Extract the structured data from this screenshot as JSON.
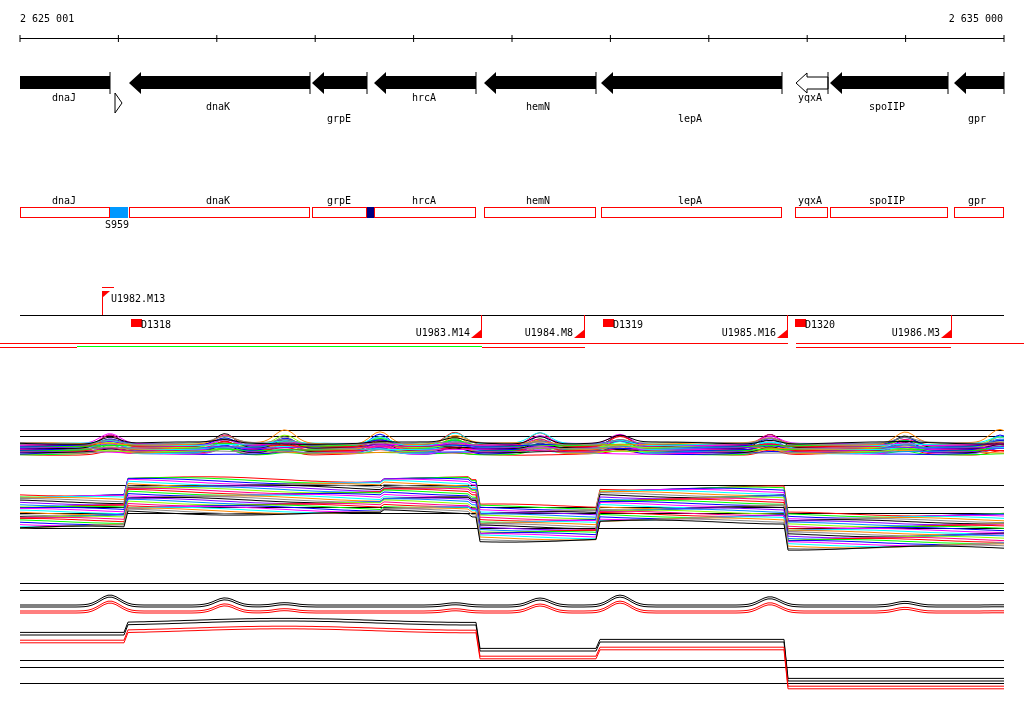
{
  "ruler": {
    "start_label": "2 625 001",
    "end_label": "2 635 000"
  },
  "genes": [
    {
      "name": "dnaJ",
      "kind": "block"
    },
    {
      "name": "dnaK",
      "kind": "arrow"
    },
    {
      "name": "grpE",
      "kind": "arrow"
    },
    {
      "name": "hrcA",
      "kind": "arrow"
    },
    {
      "name": "hemN",
      "kind": "arrow"
    },
    {
      "name": "lepA",
      "kind": "arrow"
    },
    {
      "name": "yqxA",
      "kind": "open-arrow"
    },
    {
      "name": "spoIIP",
      "kind": "arrow"
    },
    {
      "name": "gpr",
      "kind": "arrow"
    }
  ],
  "features": [
    {
      "label": "dnaJ"
    },
    {
      "label": "dnaK"
    },
    {
      "label": "grpE"
    },
    {
      "label": "hrcA"
    },
    {
      "label": "hemN"
    },
    {
      "label": "lepA"
    },
    {
      "label": "yqxA"
    },
    {
      "label": "spoIIP"
    },
    {
      "label": "gpr"
    }
  ],
  "markers": [
    {
      "label": "S959",
      "color": "#0099ff"
    },
    {
      "color": "#000080"
    }
  ],
  "transcripts": [
    {
      "label": "U1982.M13",
      "kind": "up"
    },
    {
      "label": "D1318",
      "kind": "segment"
    },
    {
      "label": "U1983.M14",
      "kind": "down"
    },
    {
      "label": "U1984.M8",
      "kind": "down"
    },
    {
      "label": "D1319",
      "kind": "segment"
    },
    {
      "label": "U1985.M16",
      "kind": "down"
    },
    {
      "label": "D1320",
      "kind": "segment"
    },
    {
      "label": "U1986.M3",
      "kind": "down"
    }
  ]
}
